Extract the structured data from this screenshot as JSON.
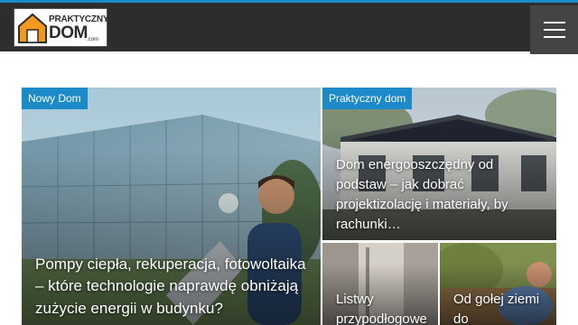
{
  "header": {
    "logo": {
      "line1": "PRAKTYCZNY",
      "line2": "DOM",
      "line3": ".com"
    },
    "menu_icon": "hamburger-icon"
  },
  "featured": [
    {
      "category": "Nowy Dom",
      "title": "Pompy ciepła, rekuperacja, fotowoltaika – które technologie naprawdę obniżają zużycie energii w budynku?"
    },
    {
      "category": "Praktyczny dom",
      "title": "Dom energooszczędny od podstaw – jak dobrać projektizolację i materiały, by rachunki…"
    },
    {
      "title": "Listwy przypodłogowe"
    },
    {
      "title": "Od gołej ziemi do"
    }
  ],
  "colors": {
    "accent": "#1c89c9",
    "header_bg": "#2d2d2d",
    "menu_bg": "#444444"
  }
}
